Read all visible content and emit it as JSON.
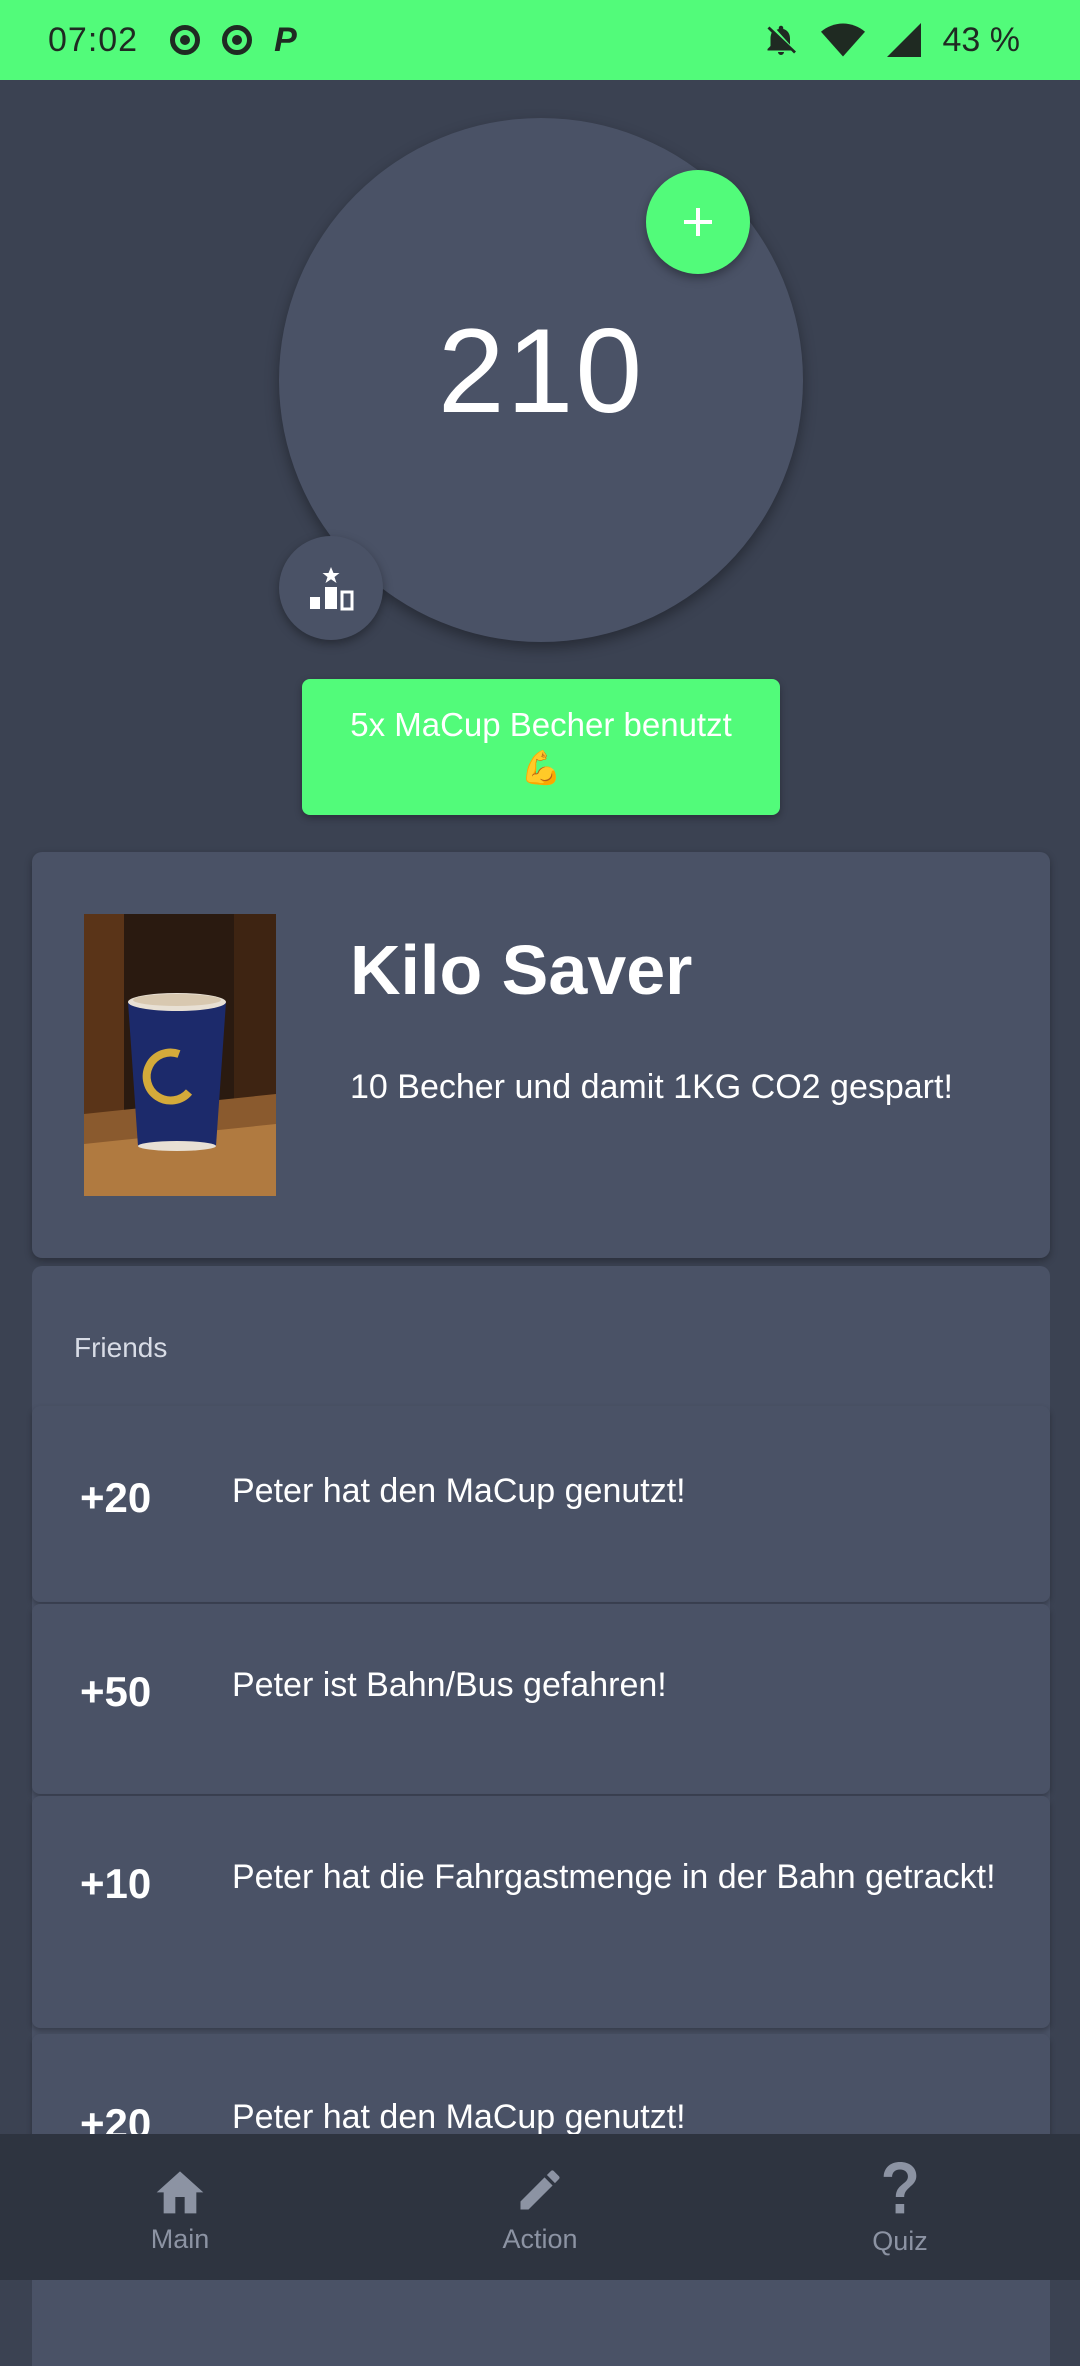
{
  "status_bar": {
    "time": "07:02",
    "battery": "43 %",
    "icons": [
      "record-icon",
      "record-icon",
      "parking-icon",
      "bell-off-icon",
      "wifi-icon",
      "signal-icon"
    ]
  },
  "score": {
    "value": "210"
  },
  "toast": {
    "line1": "5x MaCup Becher benutzt",
    "emoji": "💪"
  },
  "badge": {
    "title": "Kilo Saver",
    "description": "10 Becher und damit 1KG CO2 gespart!"
  },
  "friends": {
    "title": "Friends",
    "items": [
      {
        "points": "+20",
        "text": "Peter hat den MaCup genutzt!"
      },
      {
        "points": "+50",
        "text": "Peter ist Bahn/Bus gefahren!"
      },
      {
        "points": "+10",
        "text": "Peter hat die Fahrgastmenge in der Bahn getrackt!"
      },
      {
        "points": "+20",
        "text": "Peter hat den MaCup genutzt!"
      }
    ]
  },
  "nav": {
    "items": [
      {
        "label": "Main",
        "icon": "home-icon"
      },
      {
        "label": "Action",
        "icon": "pencil-icon"
      },
      {
        "label": "Quiz",
        "icon": "question-icon"
      }
    ]
  },
  "colors": {
    "accent": "#52fb7a",
    "background": "#3b4252",
    "card": "#4a5266",
    "nav": "#2e3440"
  }
}
